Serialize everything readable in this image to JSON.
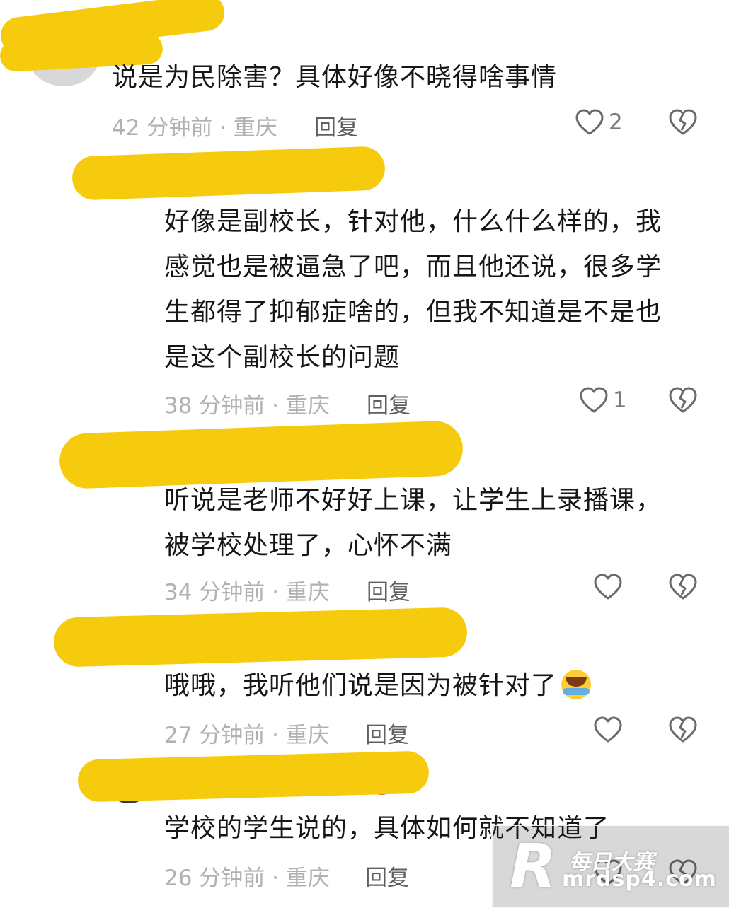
{
  "comments": [
    {
      "text": "说是为民除害？具体好像不晓得啥事情",
      "meta": "42 分钟前 · 重庆",
      "reply_label": "回复",
      "like_count": "2"
    },
    {
      "text_lines": [
        "好像是副校长，针对他，什么什么样的，我",
        "感觉也是被逼急了吧，而且他还说，很多学",
        "生都得了抑郁症啥的，但我不知道是不是也",
        "是这个副校长的问题"
      ],
      "meta": "38 分钟前 · 重庆",
      "reply_label": "回复",
      "like_count": "1"
    },
    {
      "text_lines": [
        "听说是老师不好好上课，让学生上录播课，",
        "被学校处理了，心怀不满"
      ],
      "meta": "34 分钟前 · 重庆",
      "reply_label": "回复",
      "like_count": ""
    },
    {
      "text": "哦哦，我听他们说是因为被针对了",
      "emoji": "laughing-crying-emoji",
      "meta": "27 分钟前 · 重庆",
      "reply_label": "回复",
      "like_count": ""
    },
    {
      "text": "学校的学生说的，具体如何就不知道了",
      "meta": "26 分钟前 · 重庆",
      "reply_label": "回复",
      "like_count": ""
    }
  ],
  "watermark": {
    "logo": "R",
    "name": "每日大赛",
    "site": "mrdsp4.com"
  },
  "colors": {
    "redaction": "#f6cb0e",
    "text": "#161616",
    "meta": "#b1b1b1",
    "reply": "#5f5f5f",
    "icon": "#6a6a6a"
  },
  "icons": {
    "like": "heart-outline-icon",
    "dislike": "broken-heart-icon"
  }
}
